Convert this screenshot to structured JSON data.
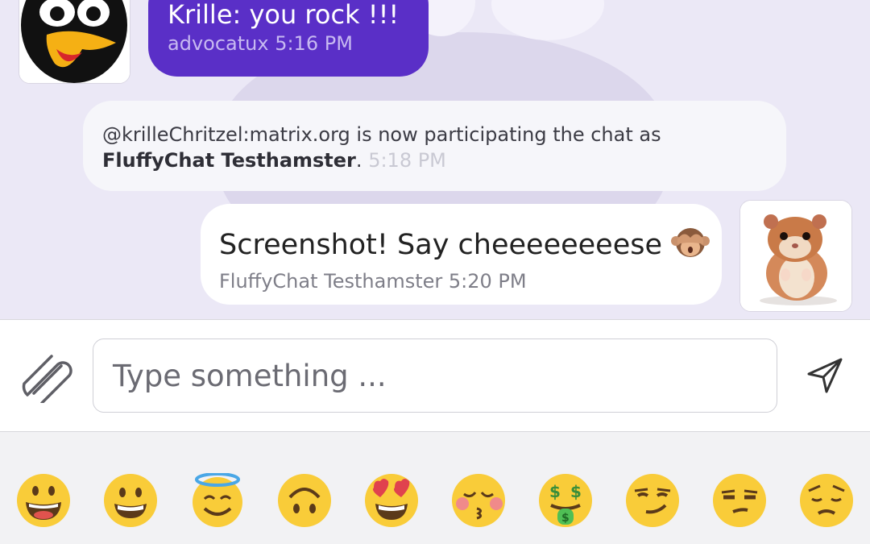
{
  "messages": {
    "own": {
      "text": "Krille: you rock !!!",
      "sender": "advocatux",
      "time": "5:16 PM",
      "avatar_icon": "penguin-avatar-icon",
      "bubble_color": "#5a2fc7"
    },
    "system": {
      "prefix": "@krilleChritzel:matrix.org is now participating the chat as",
      "name": "FluffyChat Testhamster",
      "suffix": ".",
      "time": "5:18 PM"
    },
    "other": {
      "text": "Screenshot! Say cheeeeeeeese",
      "emoji": "see-no-evil-monkey-icon",
      "sender": "FluffyChat Testhamster",
      "time": "5:20 PM",
      "avatar_icon": "hamster-avatar-icon"
    }
  },
  "composer": {
    "placeholder": "Type something ...",
    "attach_icon": "paperclip-icon",
    "send_icon": "send-icon"
  },
  "emoji_picker": {
    "items": [
      "grinning-face-big-eyes-icon",
      "grinning-face-icon",
      "smiling-face-halo-icon",
      "upside-down-face-icon",
      "heart-eyes-icon",
      "kissing-closed-eyes-icon",
      "money-mouth-face-icon",
      "smirking-face-icon",
      "unamused-face-icon",
      "pensive-face-icon"
    ]
  },
  "colors": {
    "chat_background": "#ebe8f6",
    "accent": "#5a2fc7",
    "emoji_yellow": "#f9cc39"
  }
}
